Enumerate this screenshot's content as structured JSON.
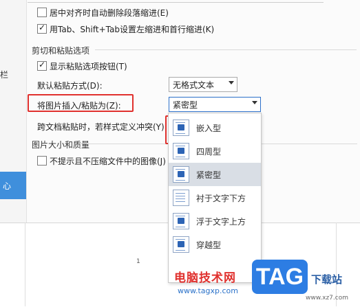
{
  "sidebar": {
    "partial_label": "栏",
    "active_item_partial": "心"
  },
  "options": {
    "auto_delete_indent": {
      "label": "居中对齐时自动删除段落缩进(E)",
      "checked": false
    },
    "tab_indent": {
      "label": "用Tab、Shift+Tab设置左缩进和首行缩进(K)",
      "checked": true
    }
  },
  "cut_paste": {
    "section_title": "剪切和粘贴选项",
    "show_paste_button": {
      "label": "显示粘贴选项按钮(T)",
      "checked": true
    },
    "default_paste": {
      "label": "默认粘贴方式(D):",
      "value": "无格式文本"
    },
    "insert_image_as": {
      "label": "将图片插入/粘贴为(Z):",
      "value": "紧密型"
    },
    "cross_doc_conflict": {
      "label": "跨文档粘贴时，若样式定义冲突(Y):"
    }
  },
  "image_quality": {
    "section_title": "图片大小和质量",
    "no_compress": {
      "label": "不提示且不压缩文件中的图像(J)",
      "checked": false
    }
  },
  "dropdown": {
    "selected_index": 2,
    "options": [
      {
        "label": "嵌入型",
        "icon": "inline-wrap-icon"
      },
      {
        "label": "四周型",
        "icon": "square-wrap-icon"
      },
      {
        "label": "紧密型",
        "icon": "tight-wrap-icon"
      },
      {
        "label": "衬于文字下方",
        "icon": "behind-text-icon"
      },
      {
        "label": "浮于文字上方",
        "icon": "in-front-of-text-icon"
      },
      {
        "label": "穿越型",
        "icon": "through-wrap-icon"
      }
    ]
  },
  "document": {
    "page_number": "1"
  },
  "watermark": {
    "site_name": "电脑技术网",
    "site_url": "www.tagxp.com",
    "logo_text": "TAG",
    "logo_subtitle": "下载站",
    "logo_url": "www.xz7.com"
  },
  "colors": {
    "highlight_red": "#e0302d",
    "accent_blue": "#3f8fdc",
    "selected_bg": "#d9dee5"
  }
}
